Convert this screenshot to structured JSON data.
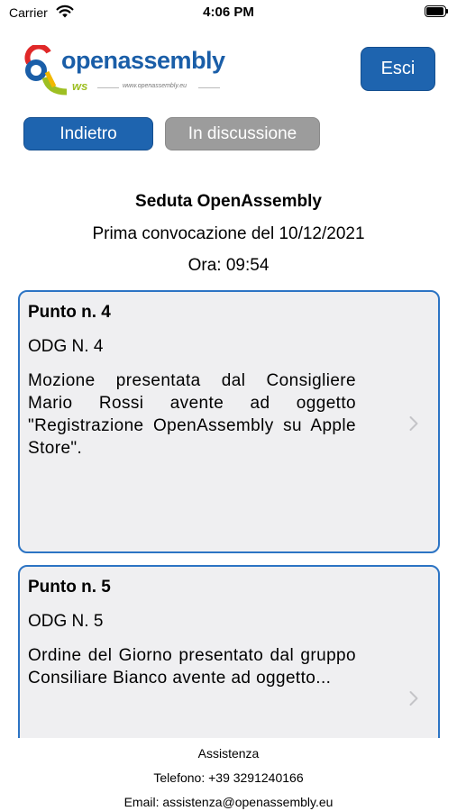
{
  "status_bar": {
    "carrier": "Carrier",
    "time": "4:06 PM"
  },
  "header": {
    "logo": {
      "name": "openassembly",
      "sub": "ws",
      "url": "www.openassembly.eu"
    },
    "esci_label": "Esci"
  },
  "nav": {
    "back_label": "Indietro",
    "discussion_label": "In discussione"
  },
  "session": {
    "title": "Seduta OpenAssembly",
    "convocation": "Prima convocazione del 10/12/2021",
    "time": "Ora: 09:54"
  },
  "items": [
    {
      "title": "Punto n. 4",
      "odg": "ODG N. 4",
      "description": "Mozione presentata dal Consigliere Mario Rossi avente ad oggetto \"Registrazione OpenAssembly su Apple Store\"."
    },
    {
      "title": "Punto n. 5",
      "odg": "ODG N. 5",
      "description": "Ordine del Giorno presentato dal gruppo Consiliare Bianco avente ad oggetto..."
    }
  ],
  "footer": {
    "support": "Assistenza",
    "phone": "Telefono: +39 3291240166",
    "email": "Email: assistenza@openassembly.eu"
  },
  "colors": {
    "primary": "#1e64af",
    "disabled": "#9c9c9c",
    "card_border": "#2c74c4",
    "card_bg": "#efeff1"
  }
}
